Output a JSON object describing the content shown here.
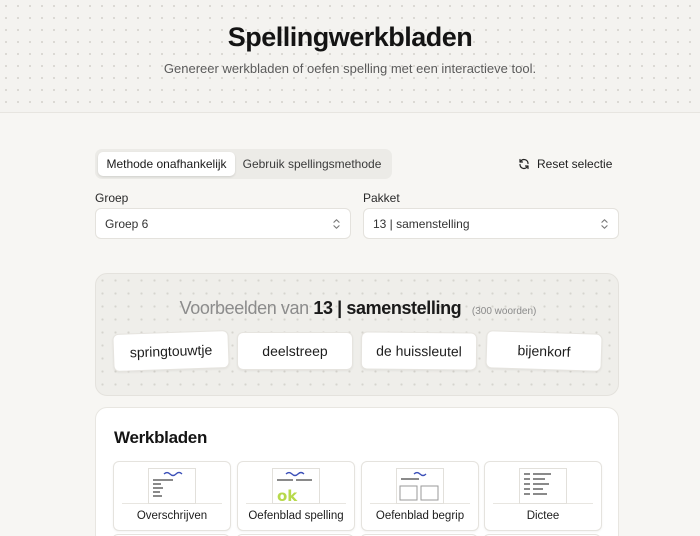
{
  "hero": {
    "title": "Spellingwerkbladen",
    "subtitle": "Genereer werkbladen of oefen spelling met een interactieve tool."
  },
  "mode_tabs": [
    {
      "label": "Methode onafhankelijk",
      "active": true
    },
    {
      "label": "Gebruik spellingsmethode",
      "active": false
    }
  ],
  "reset": {
    "label": "Reset selectie",
    "icon": "refresh-icon"
  },
  "groep": {
    "label": "Groep",
    "value": "Groep 6"
  },
  "pakket": {
    "label": "Pakket",
    "value": "13 | samenstelling"
  },
  "examples": {
    "title_prefix": "Voorbeelden van",
    "title_strong": "13 | samenstelling",
    "count": "(300 woorden)",
    "words": [
      "springtouwtje",
      "deelstreep",
      "de huissleutel",
      "bijenkorf"
    ]
  },
  "werkbladen": {
    "title": "Werkbladen",
    "cards": [
      "Overschrijven",
      "Oefenblad spelling",
      "Oefenblad begrip",
      "Dictee"
    ]
  },
  "colors": {
    "accent_blue": "#3b4fb8",
    "accent_green": "#b7d94b",
    "text": "#1f1f1f"
  }
}
